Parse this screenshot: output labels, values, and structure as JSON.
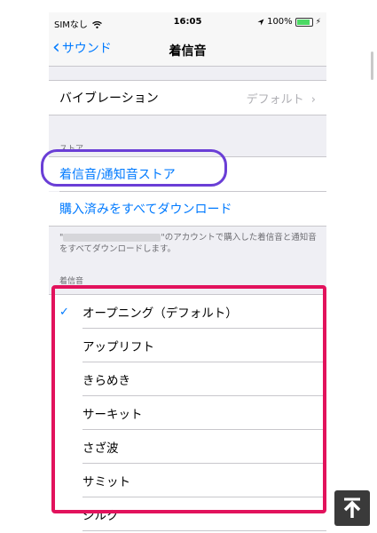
{
  "status": {
    "carrier": "SIMなし",
    "time": "16:05",
    "battery": "100%",
    "battery_level": 1.0
  },
  "nav": {
    "back_label": "サウンド",
    "title": "着信音"
  },
  "vibration": {
    "label": "バイブレーション",
    "value": "デフォルト"
  },
  "store": {
    "header": "ストア",
    "store_link": "着信音/通知音ストア",
    "download_all": "購入済みをすべてダウンロード",
    "note_prefix": "\"",
    "note_suffix": "\"のアカウントで購入した着信音と通知音をすべてダウンロードします。"
  },
  "ringtones": {
    "header": "着信音",
    "selected_index": 0,
    "items": [
      "オープニング（デフォルト）",
      "アップリフト",
      "きらめき",
      "サーキット",
      "さざ波",
      "サミット",
      "シルク"
    ]
  },
  "colors": {
    "accent": "#007aff",
    "annotation_purple": "#6a3ed6",
    "annotation_pink": "#e2125c"
  },
  "icons": {
    "wifi": "wifi-icon",
    "location": "location-arrow-icon",
    "battery": "battery-icon",
    "back": "chevron-left-icon",
    "disclosure": "chevron-right-icon",
    "check": "checkmark-icon",
    "scroll_top": "arrow-up-to-line-icon"
  }
}
